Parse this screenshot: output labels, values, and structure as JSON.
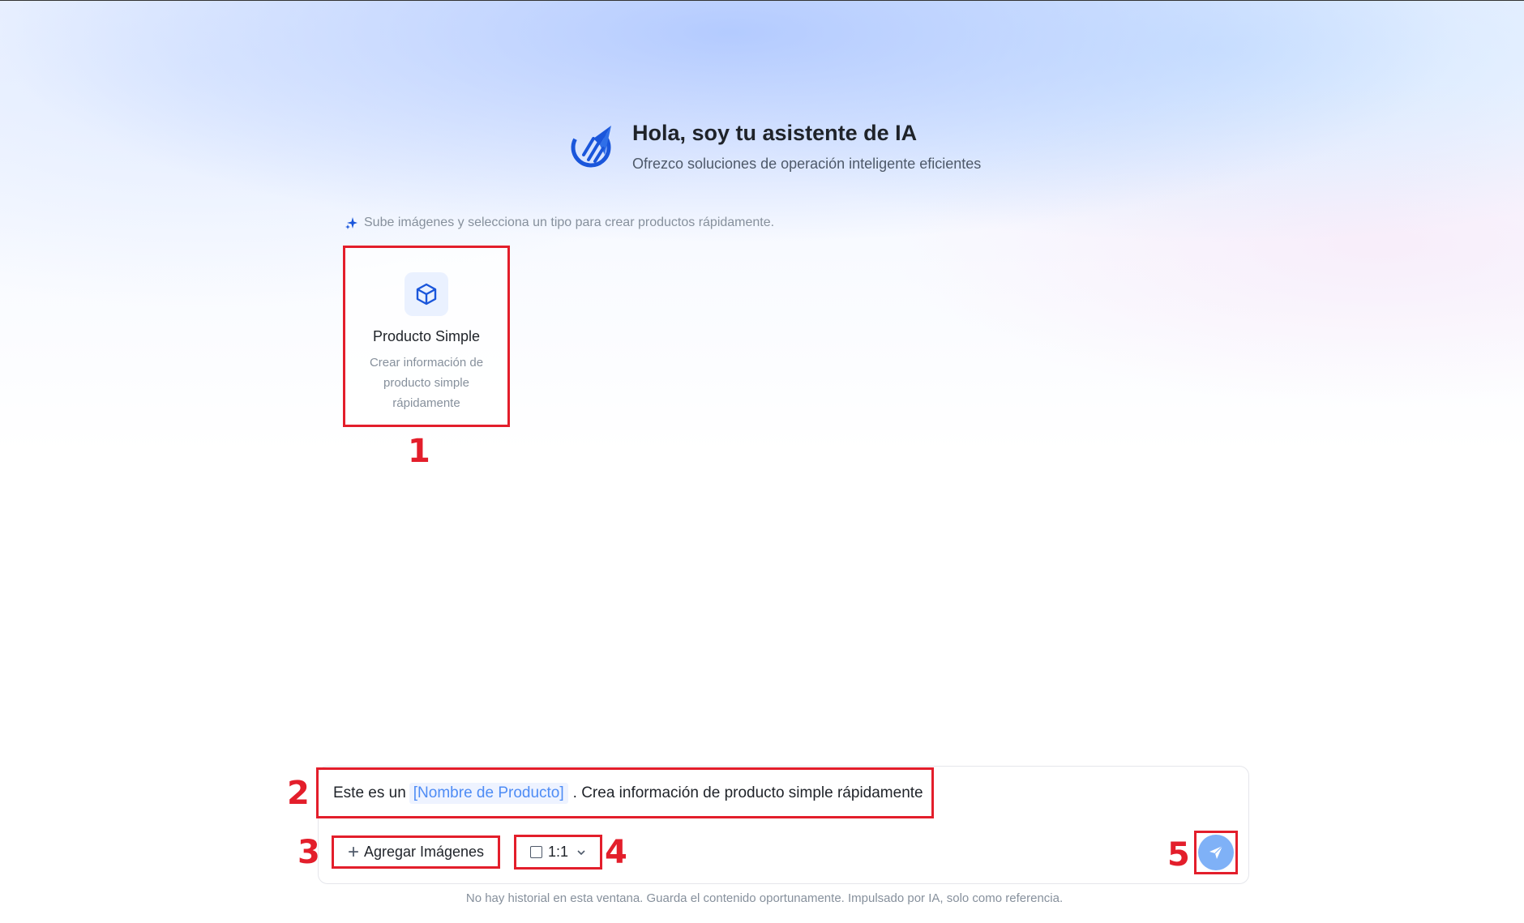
{
  "header": {
    "title": "Hola, soy tu asistente de IA",
    "subtitle": "Ofrezco soluciones de operación inteligente eficientes",
    "logo_icon": "rocket-icon"
  },
  "hint": {
    "icon": "sparkle-icon",
    "text": "Sube imágenes y selecciona un tipo para crear productos rápidamente."
  },
  "product_types": [
    {
      "icon": "cube-icon",
      "title": "Producto Simple",
      "description": "Crear información de producto simple rápidamente"
    }
  ],
  "prompt": {
    "prefix": "Este es un",
    "placeholder_slot": "[Nombre de Producto]",
    "suffix": ". Crea información de producto simple rápidamente"
  },
  "toolbar": {
    "add_images_label": "Agregar Imágenes",
    "aspect_ratio_value": "1:1",
    "send_icon": "send-icon"
  },
  "footer": {
    "disclaimer": "No hay historial en esta ventana. Guarda el contenido oportunamente. Impulsado por IA, solo como referencia."
  },
  "annotations": [
    "1",
    "2",
    "3",
    "4",
    "5"
  ],
  "colors": {
    "annotation_red": "#e31e2b",
    "accent_blue": "#1a56db",
    "slot_blue": "#4e8cf5",
    "send_button": "#7fb1f7"
  }
}
